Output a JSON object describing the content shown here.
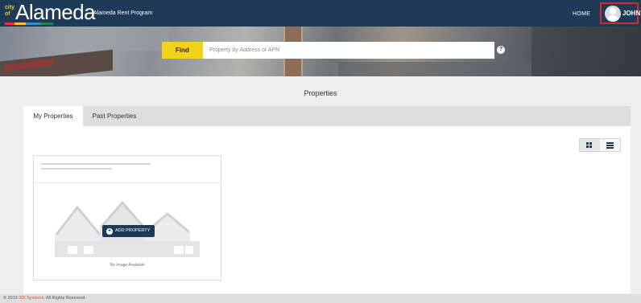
{
  "header": {
    "logo_city": "city of",
    "logo_word": "Alameda",
    "program_name": "Alameda Rent Program",
    "home_label": "HOME",
    "user_name": "JOHN"
  },
  "colors": {
    "navbar": "#1e3a56",
    "find_button": "#f2d21a",
    "user_highlight": "#d42a2a",
    "logo_stripes": [
      "#e8322f",
      "#f2c230",
      "#2c8fd6",
      "#1e8a4a"
    ]
  },
  "search": {
    "button_label": "Find",
    "placeholder": "Property by Address or APN",
    "value": "",
    "help_icon": "question-circle-icon"
  },
  "main": {
    "title": "Properties",
    "tabs": [
      {
        "label": "My Properties",
        "active": true
      },
      {
        "label": "Past Properties",
        "active": false
      }
    ],
    "view_modes": [
      {
        "icon": "grid-view-icon",
        "active": true
      },
      {
        "icon": "list-view-icon",
        "active": false
      }
    ],
    "property_card": {
      "add_button_icon": "plus-circle-icon",
      "add_button_label": "ADD PROPERTY",
      "no_image_text": "No Image Available",
      "placeholder_icon": "house-placeholder-icon"
    }
  },
  "footer": {
    "copyright_prefix": "© 2019 ",
    "company": "3Di Systems",
    "copyright_suffix": ". All Rights Reserved."
  }
}
